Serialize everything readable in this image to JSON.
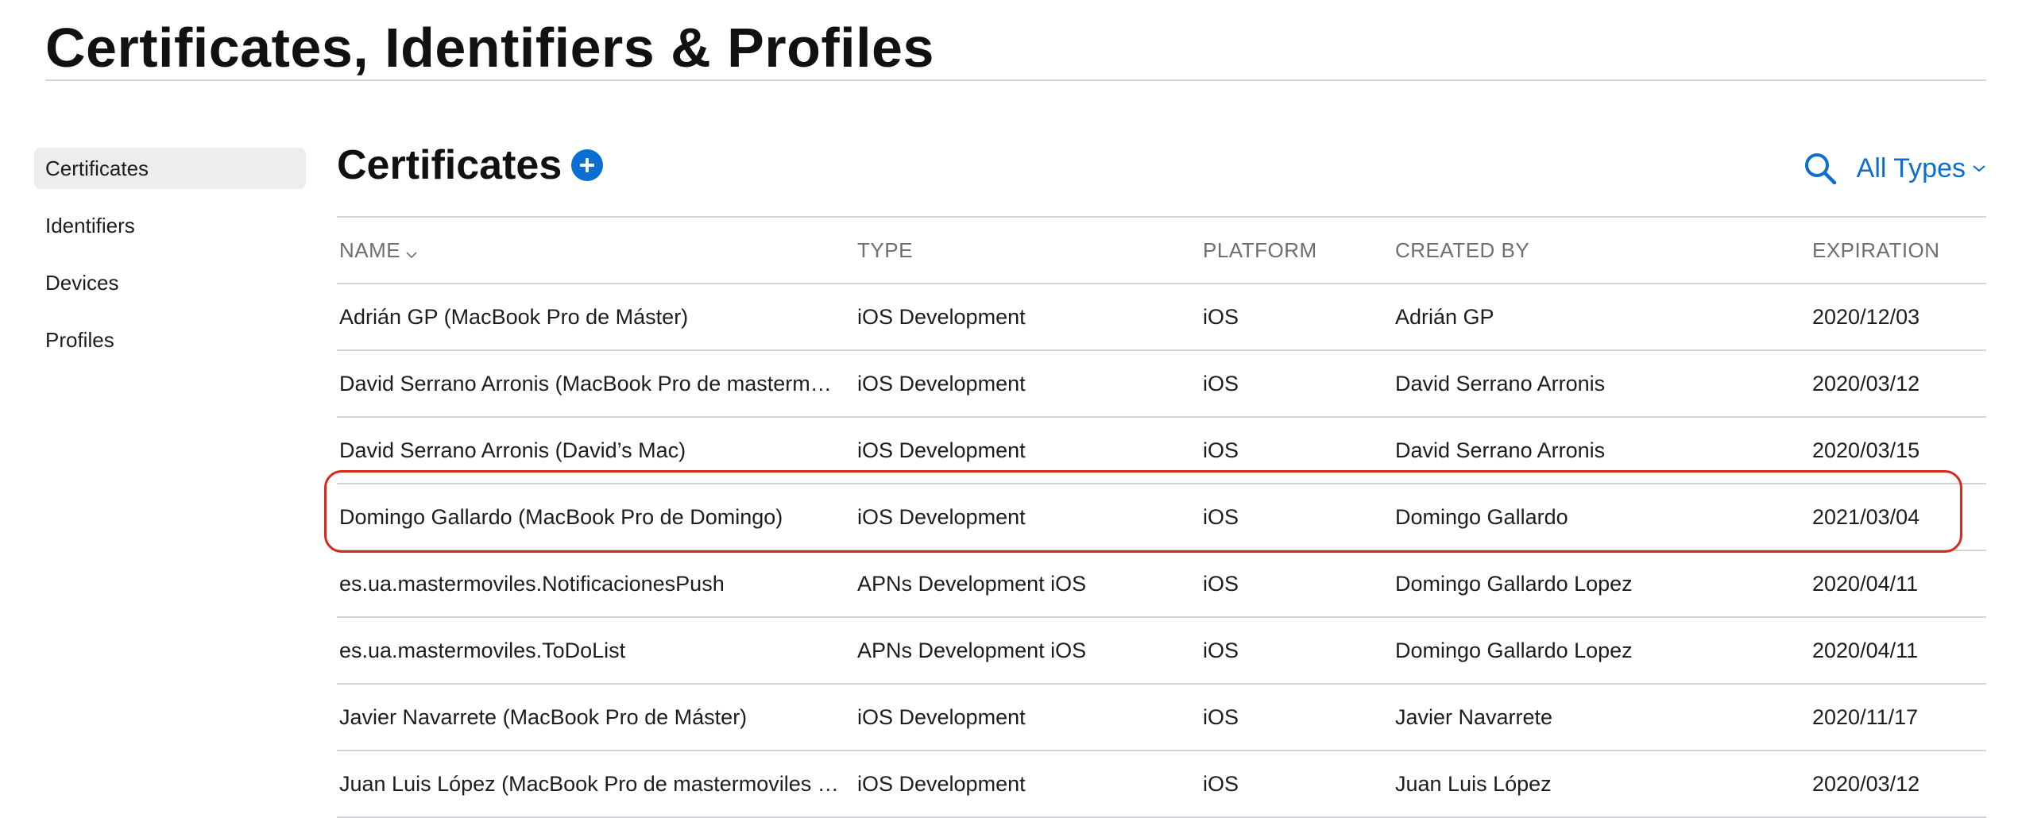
{
  "page": {
    "title": "Certificates, Identifiers & Profiles"
  },
  "sidebar": {
    "items": [
      {
        "label": "Certificates",
        "selected": true
      },
      {
        "label": "Identifiers",
        "selected": false
      },
      {
        "label": "Devices",
        "selected": false
      },
      {
        "label": "Profiles",
        "selected": false
      }
    ]
  },
  "section": {
    "title": "Certificates",
    "add_icon": "plus-circle-icon",
    "search_icon": "search-icon",
    "filter_label": "All Types",
    "filter_icon": "chevron-down-icon"
  },
  "table": {
    "columns": {
      "name": "NAME",
      "type": "TYPE",
      "platform": "PLATFORM",
      "created_by": "CREATED BY",
      "expiration": "EXPIRATION"
    },
    "sort_column": "NAME",
    "rows": [
      {
        "name": "Adrián GP (MacBook Pro de Máster)",
        "type": "iOS Development",
        "platform": "iOS",
        "created_by": "Adrián GP",
        "expiration": "2020/12/03"
      },
      {
        "name": "David Serrano Arronis (MacBook Pro de masterm…",
        "type": "iOS Development",
        "platform": "iOS",
        "created_by": "David Serrano Arronis",
        "expiration": "2020/03/12"
      },
      {
        "name": "David Serrano Arronis (David’s Mac)",
        "type": "iOS Development",
        "platform": "iOS",
        "created_by": "David Serrano Arronis",
        "expiration": "2020/03/15"
      },
      {
        "name": "Domingo Gallardo (MacBook Pro de Domingo)",
        "type": "iOS Development",
        "platform": "iOS",
        "created_by": "Domingo Gallardo",
        "expiration": "2021/03/04"
      },
      {
        "name": "es.ua.mastermoviles.NotificacionesPush",
        "type": "APNs Development iOS",
        "platform": "iOS",
        "created_by": "Domingo Gallardo Lopez",
        "expiration": "2020/04/11"
      },
      {
        "name": "es.ua.mastermoviles.ToDoList",
        "type": "APNs Development iOS",
        "platform": "iOS",
        "created_by": "Domingo Gallardo Lopez",
        "expiration": "2020/04/11"
      },
      {
        "name": "Javier Navarrete (MacBook Pro de Máster)",
        "type": "iOS Development",
        "platform": "iOS",
        "created_by": "Javier Navarrete",
        "expiration": "2020/11/17"
      },
      {
        "name": "Juan Luis López (MacBook Pro de mastermoviles …",
        "type": "iOS Development",
        "platform": "iOS",
        "created_by": "Juan Luis López",
        "expiration": "2020/03/12"
      }
    ],
    "highlighted_row": 3
  },
  "colors": {
    "accent": "#0b6fd1",
    "highlight": "#d8281d",
    "divider": "#d2d2d7",
    "sidebar_selected_bg": "#ededed"
  }
}
